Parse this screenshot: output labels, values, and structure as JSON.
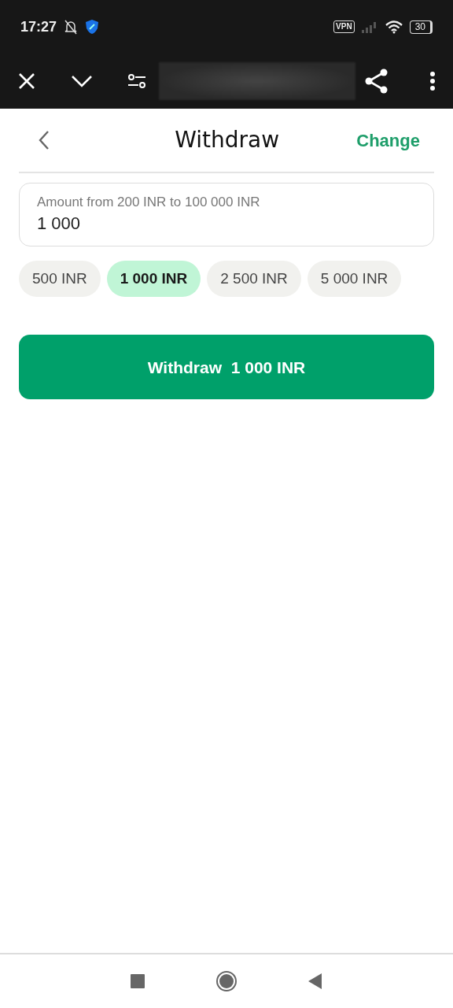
{
  "status_bar": {
    "time": "17:27",
    "vpn": "VPN",
    "battery": "30"
  },
  "header": {
    "title": "Withdraw",
    "action": "Change"
  },
  "amount_field": {
    "placeholder": "Amount from 200 INR to 100 000 INR",
    "value": "1 000"
  },
  "presets": [
    {
      "label": "500 INR",
      "selected": false
    },
    {
      "label": "1 000 INR",
      "selected": true
    },
    {
      "label": "2 500 INR",
      "selected": false
    },
    {
      "label": "5 000 INR",
      "selected": false
    }
  ],
  "submit_button": {
    "label": "Withdraw  1 000 INR"
  }
}
